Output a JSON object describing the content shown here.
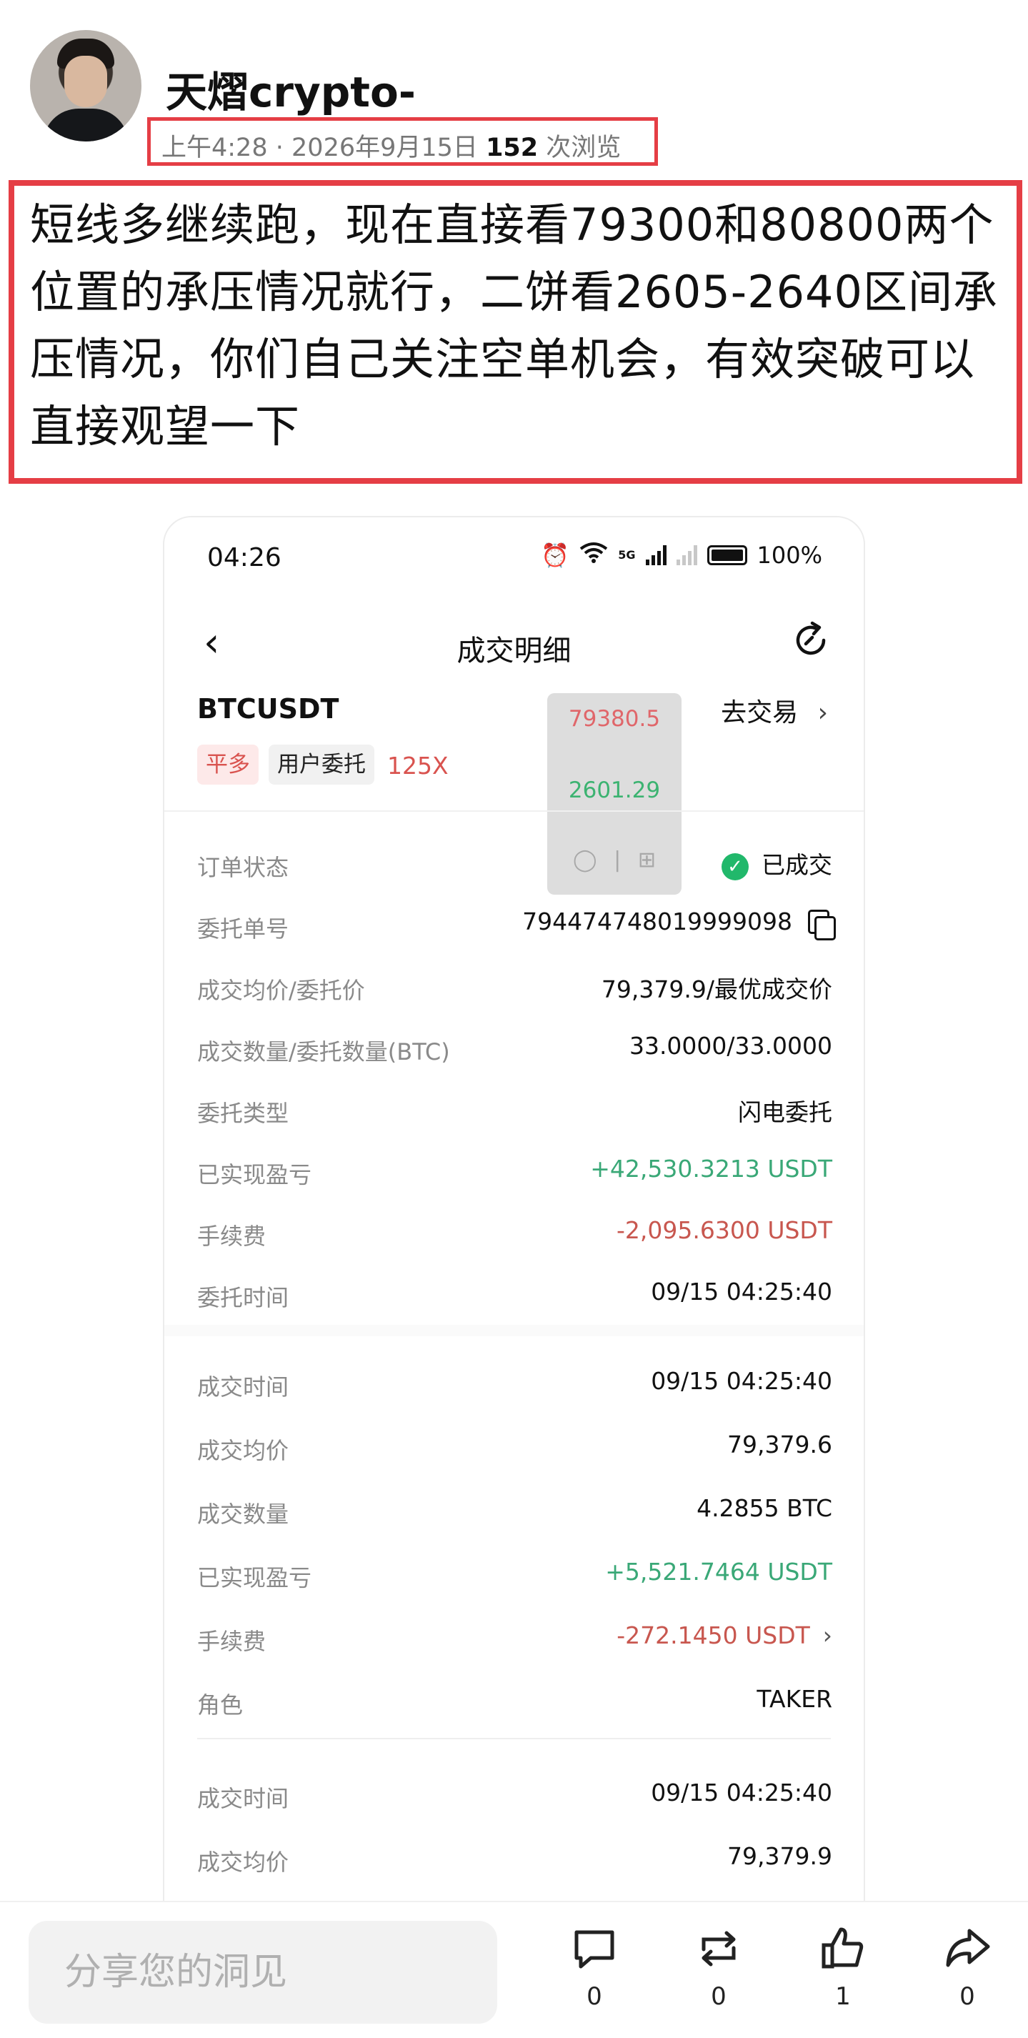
{
  "post": {
    "username": "天熠crypto-",
    "time": "上午4:28",
    "separator": "·",
    "date": "2026年9月15日",
    "views_count": "152",
    "views_label": "次浏览",
    "content": "短线多继续跑，现在直接看79300和80800两个位置的承压情况就行，二饼看2605-2640区间承压情况，你们自己关注空单机会，有效突破可以直接观望一下"
  },
  "screenshot": {
    "status_time": "04:26",
    "status_network": "5G",
    "battery": "100%",
    "nav_title": "成交明细",
    "symbol": "BTCUSDT",
    "go_trade": "去交易",
    "tags": {
      "close": "平多",
      "user": "用户委托",
      "leverage": "125X"
    },
    "overlay": {
      "price1": "79380.5",
      "price2": "2601.29"
    },
    "order": [
      {
        "label": "订单状态",
        "value": "已成交"
      },
      {
        "label": "委托单号",
        "value": "794474748019999098"
      },
      {
        "label": "成交均价/委托价",
        "value": "79,379.9/最优成交价"
      },
      {
        "label": "成交数量/委托数量(BTC)",
        "value": "33.0000/33.0000"
      },
      {
        "label": "委托类型",
        "value": "闪电委托"
      },
      {
        "label": "已实现盈亏",
        "value": "+42,530.3213 USDT"
      },
      {
        "label": "手续费",
        "value": "-2,095.6300 USDT"
      },
      {
        "label": "委托时间",
        "value": "09/15 04:25:40"
      }
    ],
    "fill1": [
      {
        "label": "成交时间",
        "value": "09/15 04:25:40"
      },
      {
        "label": "成交均价",
        "value": "79,379.6"
      },
      {
        "label": "成交数量",
        "value": "4.2855 BTC"
      },
      {
        "label": "已实现盈亏",
        "value": "+5,521.7464 USDT"
      },
      {
        "label": "手续费",
        "value": "-272.1450 USDT"
      },
      {
        "label": "角色",
        "value": "TAKER"
      }
    ],
    "fill2": [
      {
        "label": "成交时间",
        "value": "09/15 04:25:40"
      },
      {
        "label": "成交均价",
        "value": "79,379.9"
      }
    ]
  },
  "bottom_bar": {
    "share_placeholder": "分享您的洞见",
    "comment_count": "0",
    "repost_count": "0",
    "like_count": "1",
    "share_count": "0"
  },
  "colors": {
    "highlight_border": "#e53e45",
    "profit": "#3aa877",
    "loss": "#c8574f"
  }
}
